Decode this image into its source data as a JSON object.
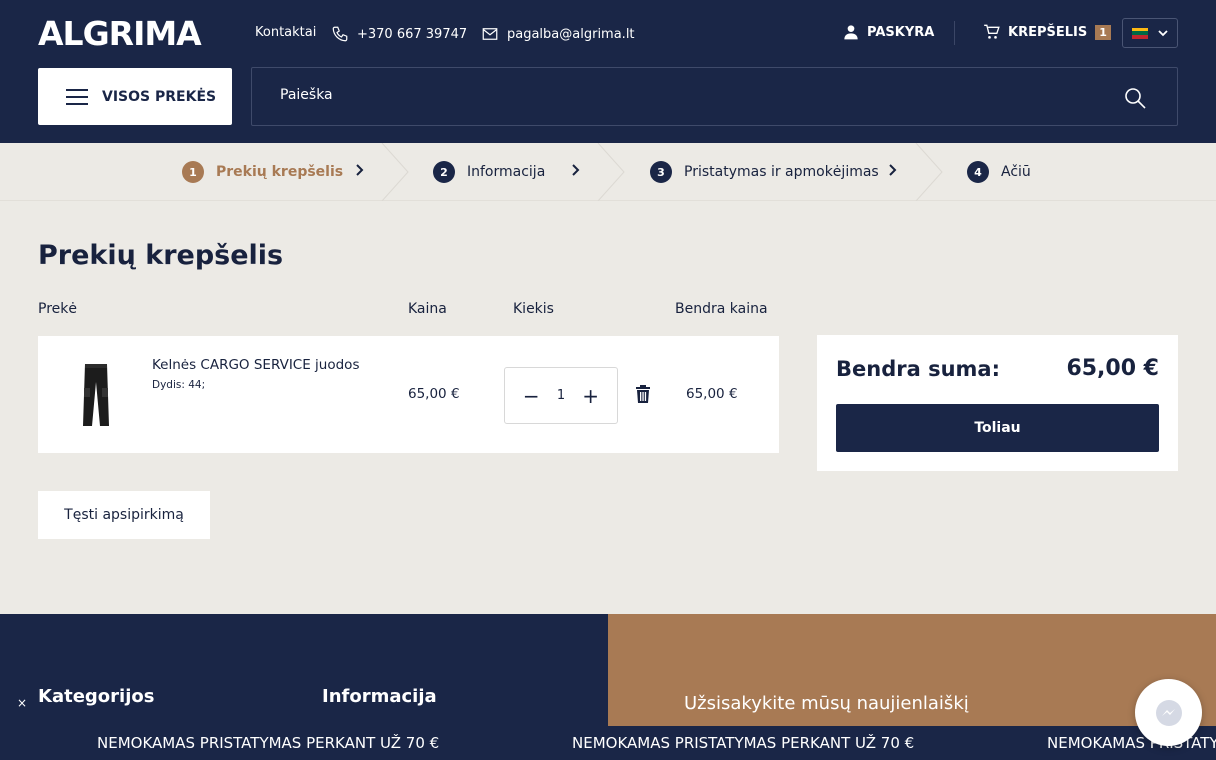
{
  "header": {
    "logo": "ALGRIMA",
    "contacts": "Kontaktai",
    "phone": "+370 667 39747",
    "email": "pagalba@algrima.lt",
    "account": "PASKYRA",
    "cart_label": "KREPŠELIS",
    "cart_count": "1",
    "all_products": "VISOS PREKĖS",
    "search_placeholder": "Paieška"
  },
  "steps": [
    {
      "num": "1",
      "label": "Prekių krepšelis"
    },
    {
      "num": "2",
      "label": "Informacija"
    },
    {
      "num": "3",
      "label": "Pristatymas ir apmokėjimas"
    },
    {
      "num": "4",
      "label": "Ačiū"
    }
  ],
  "cart": {
    "title": "Prekių krepšelis",
    "columns": {
      "product": "Prekė",
      "price": "Kaina",
      "quantity": "Kiekis",
      "total": "Bendra kaina"
    },
    "items": [
      {
        "name": "Kelnės CARGO SERVICE juodos",
        "size": "Dydis: 44;",
        "price": "65,00 €",
        "quantity": "1",
        "total": "65,00 €"
      }
    ],
    "continue_label": "Tęsti apsipirkimą"
  },
  "summary": {
    "label": "Bendra suma:",
    "value": "65,00 €",
    "next_label": "Toliau"
  },
  "footer": {
    "categories": "Kategorijos",
    "information": "Informacija",
    "newsletter": "Užsisakykite mūsų naujienlaiškį",
    "close": "×",
    "ticker": "NEMOKAMAS PRISTATYMAS PERKANT UŽ 70 €"
  },
  "colors": {
    "navy": "#1a2647",
    "accent": "#a87a54",
    "background": "#eceae5"
  }
}
